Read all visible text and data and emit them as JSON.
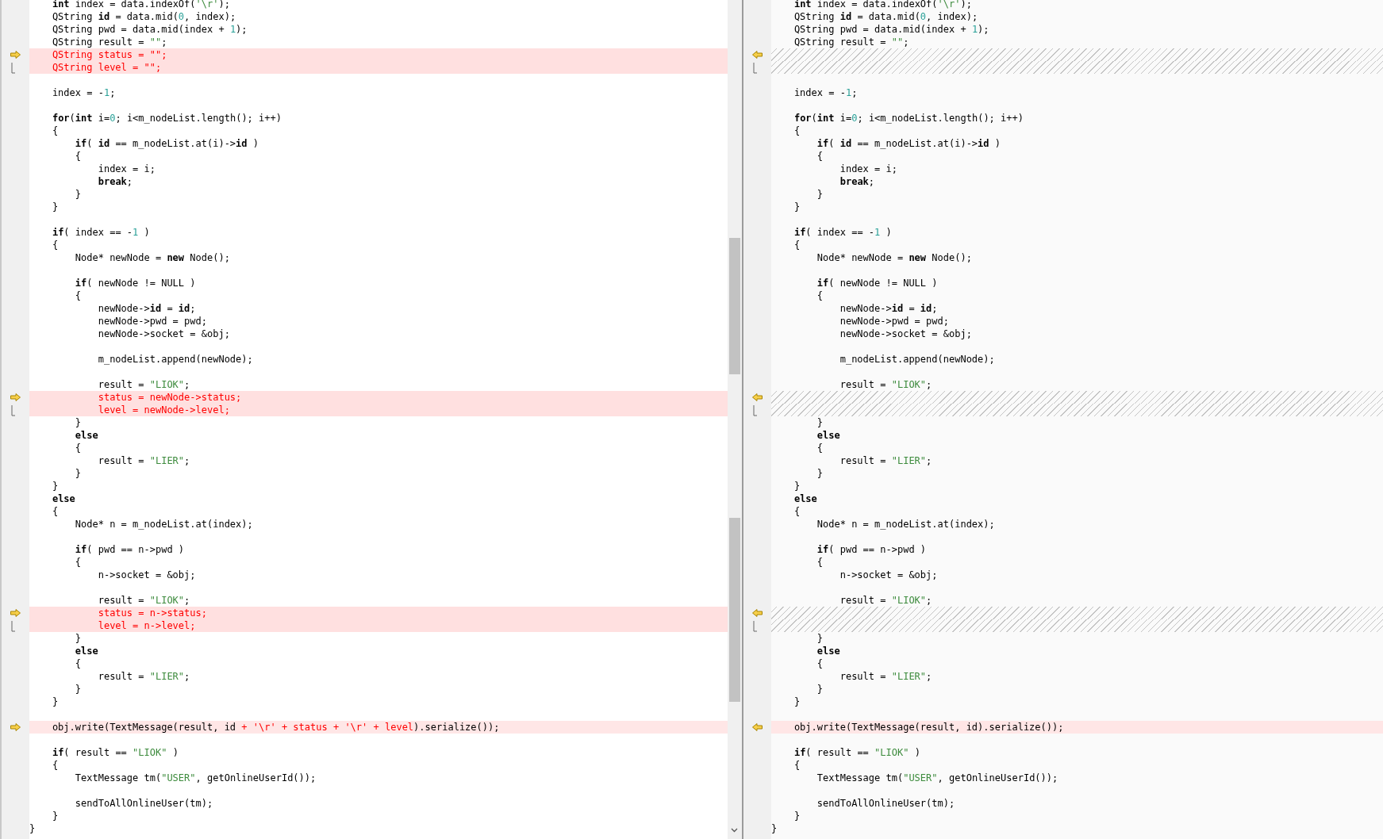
{
  "panes": [
    {
      "kind": "left",
      "lines": [
        {
          "kind": "same",
          "text": "    **int** index = data.indexOf('\\r');"
        },
        {
          "kind": "same",
          "text": "    QString **id** = data.mid(0, index);"
        },
        {
          "kind": "same",
          "text": "    QString pwd = data.mid(index + 1);"
        },
        {
          "kind": "same",
          "text": "    QString result = \"\";"
        },
        {
          "kind": "deleted",
          "arrow": true,
          "text": "    QString status = \"\";"
        },
        {
          "kind": "deleted",
          "bracket": true,
          "text": "    QString level = \"\";"
        },
        {
          "kind": "blank"
        },
        {
          "kind": "same",
          "text": "    index = -1;"
        },
        {
          "kind": "blank"
        },
        {
          "kind": "same",
          "text": "    **for**(**int** i=0; i<m_nodeList.length(); i++)"
        },
        {
          "kind": "same",
          "text": "    {"
        },
        {
          "kind": "same",
          "text": "        **if**( **id** == m_nodeList.at(i)->**id** )"
        },
        {
          "kind": "same",
          "text": "        {"
        },
        {
          "kind": "same",
          "text": "            index = i;"
        },
        {
          "kind": "same",
          "text": "            **break**;"
        },
        {
          "kind": "same",
          "text": "        }"
        },
        {
          "kind": "same",
          "text": "    }"
        },
        {
          "kind": "blank"
        },
        {
          "kind": "same",
          "text": "    **if**( index == -1 )"
        },
        {
          "kind": "same",
          "text": "    {"
        },
        {
          "kind": "same",
          "text": "        Node* newNode = **new** Node();"
        },
        {
          "kind": "blank"
        },
        {
          "kind": "same",
          "text": "        **if**( newNode != NULL )"
        },
        {
          "kind": "same",
          "text": "        {"
        },
        {
          "kind": "same",
          "text": "            newNode->**id** = **id**;"
        },
        {
          "kind": "same",
          "text": "            newNode->pwd = pwd;"
        },
        {
          "kind": "same",
          "text": "            newNode->socket = &obj;"
        },
        {
          "kind": "blank"
        },
        {
          "kind": "same",
          "text": "            m_nodeList.append(newNode);"
        },
        {
          "kind": "blank"
        },
        {
          "kind": "same",
          "text": "            result = \"LIOK\";"
        },
        {
          "kind": "deleted",
          "arrow": true,
          "text": "            status = newNode->status;"
        },
        {
          "kind": "deleted",
          "bracket": true,
          "text": "            level = newNode->level;"
        },
        {
          "kind": "same",
          "text": "        }"
        },
        {
          "kind": "same",
          "text": "        **else**"
        },
        {
          "kind": "same",
          "text": "        {"
        },
        {
          "kind": "same",
          "text": "            result = \"LIER\";"
        },
        {
          "kind": "same",
          "text": "        }"
        },
        {
          "kind": "same",
          "text": "    }"
        },
        {
          "kind": "same",
          "text": "    **else**"
        },
        {
          "kind": "same",
          "text": "    {"
        },
        {
          "kind": "same",
          "text": "        Node* n = m_nodeList.at(index);"
        },
        {
          "kind": "blank"
        },
        {
          "kind": "same",
          "text": "        **if**( pwd == n->pwd )"
        },
        {
          "kind": "same",
          "text": "        {"
        },
        {
          "kind": "same",
          "text": "            n->socket = &obj;"
        },
        {
          "kind": "blank"
        },
        {
          "kind": "same",
          "text": "            result = \"LIOK\";"
        },
        {
          "kind": "deleted",
          "arrow": true,
          "text": "            status = n->status;"
        },
        {
          "kind": "deleted",
          "bracket": true,
          "text": "            level = n->level;"
        },
        {
          "kind": "same",
          "text": "        }"
        },
        {
          "kind": "same",
          "text": "        **else**"
        },
        {
          "kind": "same",
          "text": "        {"
        },
        {
          "kind": "same",
          "text": "            result = \"LIER\";"
        },
        {
          "kind": "same",
          "text": "        }"
        },
        {
          "kind": "same",
          "text": "    }"
        },
        {
          "kind": "blank"
        },
        {
          "kind": "changed",
          "arrow": true,
          "parts": [
            {
              "text": "    obj.write(TextMessage(result, id ",
              "changed": false
            },
            {
              "text": "+ '\\r' + status + '\\r' + level",
              "changed": true
            },
            {
              "text": ").serialize());",
              "changed": false
            }
          ]
        },
        {
          "kind": "blank"
        },
        {
          "kind": "same",
          "text": "    **if**( result == \"LIOK\" )"
        },
        {
          "kind": "same",
          "text": "    {"
        },
        {
          "kind": "same",
          "text": "        TextMessage tm(\"USER\", getOnlineUserId());"
        },
        {
          "kind": "blank"
        },
        {
          "kind": "same",
          "text": "        sendToAllOnlineUser(tm);"
        },
        {
          "kind": "same",
          "text": "    }"
        },
        {
          "kind": "same",
          "text": "}"
        }
      ]
    },
    {
      "kind": "right",
      "lines": [
        {
          "kind": "same",
          "text": "    **int** index = data.indexOf('\\r');"
        },
        {
          "kind": "same",
          "text": "    QString **id** = data.mid(0, index);"
        },
        {
          "kind": "same",
          "text": "    QString pwd = data.mid(index + 1);"
        },
        {
          "kind": "same",
          "text": "    QString result = \"\";"
        },
        {
          "kind": "gap",
          "arrow": true
        },
        {
          "kind": "gap",
          "bracket": true
        },
        {
          "kind": "blank"
        },
        {
          "kind": "same",
          "text": "    index = -1;"
        },
        {
          "kind": "blank"
        },
        {
          "kind": "same",
          "text": "    **for**(**int** i=0; i<m_nodeList.length(); i++)"
        },
        {
          "kind": "same",
          "text": "    {"
        },
        {
          "kind": "same",
          "text": "        **if**( **id** == m_nodeList.at(i)->**id** )"
        },
        {
          "kind": "same",
          "text": "        {"
        },
        {
          "kind": "same",
          "text": "            index = i;"
        },
        {
          "kind": "same",
          "text": "            **break**;"
        },
        {
          "kind": "same",
          "text": "        }"
        },
        {
          "kind": "same",
          "text": "    }"
        },
        {
          "kind": "blank"
        },
        {
          "kind": "same",
          "text": "    **if**( index == -1 )"
        },
        {
          "kind": "same",
          "text": "    {"
        },
        {
          "kind": "same",
          "text": "        Node* newNode = **new** Node();"
        },
        {
          "kind": "blank"
        },
        {
          "kind": "same",
          "text": "        **if**( newNode != NULL )"
        },
        {
          "kind": "same",
          "text": "        {"
        },
        {
          "kind": "same",
          "text": "            newNode->**id** = **id**;"
        },
        {
          "kind": "same",
          "text": "            newNode->pwd = pwd;"
        },
        {
          "kind": "same",
          "text": "            newNode->socket = &obj;"
        },
        {
          "kind": "blank"
        },
        {
          "kind": "same",
          "text": "            m_nodeList.append(newNode);"
        },
        {
          "kind": "blank"
        },
        {
          "kind": "same",
          "text": "            result = \"LIOK\";"
        },
        {
          "kind": "gap",
          "arrow": true
        },
        {
          "kind": "gap",
          "bracket": true
        },
        {
          "kind": "same",
          "text": "        }"
        },
        {
          "kind": "same",
          "text": "        **else**"
        },
        {
          "kind": "same",
          "text": "        {"
        },
        {
          "kind": "same",
          "text": "            result = \"LIER\";"
        },
        {
          "kind": "same",
          "text": "        }"
        },
        {
          "kind": "same",
          "text": "    }"
        },
        {
          "kind": "same",
          "text": "    **else**"
        },
        {
          "kind": "same",
          "text": "    {"
        },
        {
          "kind": "same",
          "text": "        Node* n = m_nodeList.at(index);"
        },
        {
          "kind": "blank"
        },
        {
          "kind": "same",
          "text": "        **if**( pwd == n->pwd )"
        },
        {
          "kind": "same",
          "text": "        {"
        },
        {
          "kind": "same",
          "text": "            n->socket = &obj;"
        },
        {
          "kind": "blank"
        },
        {
          "kind": "same",
          "text": "            result = \"LIOK\";"
        },
        {
          "kind": "gap",
          "arrow": true
        },
        {
          "kind": "gap",
          "bracket": true
        },
        {
          "kind": "same",
          "text": "        }"
        },
        {
          "kind": "same",
          "text": "        **else**"
        },
        {
          "kind": "same",
          "text": "        {"
        },
        {
          "kind": "same",
          "text": "            result = \"LIER\";"
        },
        {
          "kind": "same",
          "text": "        }"
        },
        {
          "kind": "same",
          "text": "    }"
        },
        {
          "kind": "blank"
        },
        {
          "kind": "changed",
          "arrow": true,
          "parts": [
            {
              "text": "    obj.write(TextMessage(result, id).serialize());",
              "changed": false
            }
          ]
        },
        {
          "kind": "blank"
        },
        {
          "kind": "same",
          "text": "    **if**( result == \"LIOK\" )"
        },
        {
          "kind": "same",
          "text": "    {"
        },
        {
          "kind": "same",
          "text": "        TextMessage tm(\"USER\", getOnlineUserId());"
        },
        {
          "kind": "blank"
        },
        {
          "kind": "same",
          "text": "        sendToAllOnlineUser(tm);"
        },
        {
          "kind": "same",
          "text": "    }"
        },
        {
          "kind": "same",
          "text": "}"
        }
      ]
    }
  ]
}
